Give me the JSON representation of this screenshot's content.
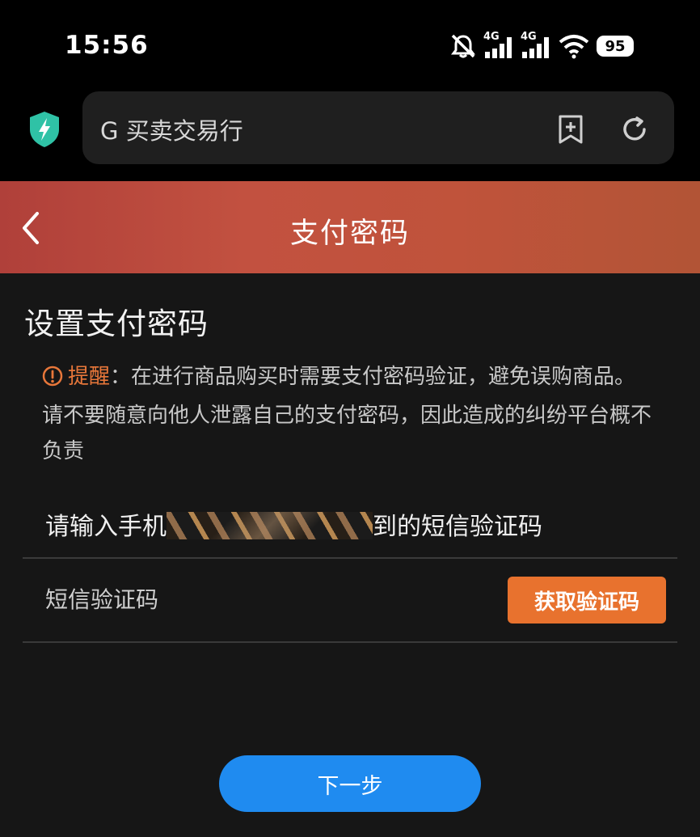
{
  "status_bar": {
    "time": "15:56",
    "network_1": "4G",
    "network_2": "4G",
    "battery": "95",
    "icons": [
      "mute-bell-icon",
      "signal-icon",
      "signal-icon",
      "wifi-icon",
      "battery-icon"
    ]
  },
  "browser": {
    "url_text": "G 买卖交易行",
    "icons": [
      "shield-bolt-icon",
      "add-bookmark-icon",
      "refresh-icon"
    ],
    "shield_color": "#2fc2a6"
  },
  "header": {
    "title": "支付密码"
  },
  "page": {
    "section_title": "设置支付密码",
    "notice_label": "提醒",
    "notice_text": "：在进行商品购买时需要支付密码验证，避免误购商品。请不要随意向他人泄露自己的支付密码，因此造成的纠纷平台概不负责",
    "sms_prompt_prefix": "请输入手机",
    "sms_prompt_suffix": "到的短信验证码",
    "sms_placeholder": "短信验证码",
    "get_code_label": "获取验证码",
    "next_label": "下一步"
  },
  "colors": {
    "accent_orange": "#e8722e",
    "primary_blue": "#1f8bf0",
    "header_red": "#c0503e",
    "background": "#161616"
  }
}
